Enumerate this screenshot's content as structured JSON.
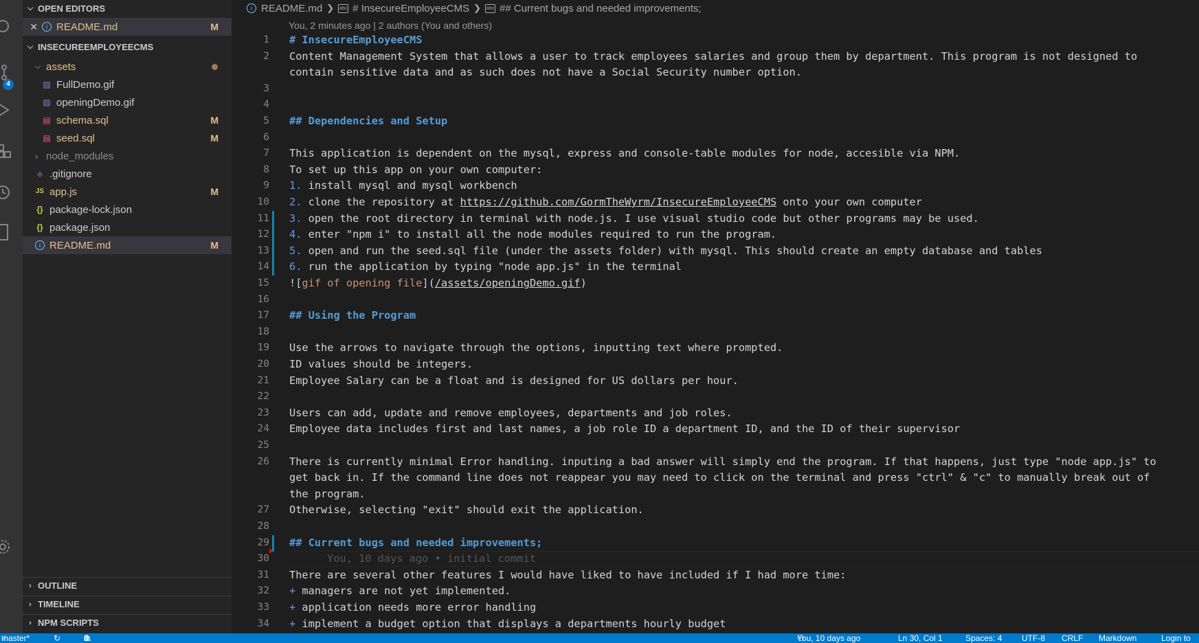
{
  "sidebar": {
    "open_editors": {
      "title": "OPEN EDITORS",
      "items": [
        {
          "label": "README.md",
          "status": "M"
        }
      ]
    },
    "explorer": {
      "title": "INSECUREEMPLOYEECMS",
      "items": [
        {
          "label": "assets",
          "type": "folder-open"
        },
        {
          "label": "FullDemo.gif",
          "type": "image"
        },
        {
          "label": "openingDemo.gif",
          "type": "image"
        },
        {
          "label": "schema.sql",
          "type": "database",
          "status": "M"
        },
        {
          "label": "seed.sql",
          "type": "database",
          "status": "M"
        },
        {
          "label": "node_modules",
          "type": "folder-closed"
        },
        {
          "label": ".gitignore",
          "type": "git"
        },
        {
          "label": "app.js",
          "type": "javascript",
          "status": "M"
        },
        {
          "label": "package-lock.json",
          "type": "json"
        },
        {
          "label": "package.json",
          "type": "json"
        },
        {
          "label": "README.md",
          "type": "info",
          "status": "M"
        }
      ]
    },
    "bottom_sections": [
      "OUTLINE",
      "TIMELINE",
      "NPM SCRIPTS"
    ],
    "source_control_badge": "4"
  },
  "editor": {
    "breadcrumb": [
      "README.md",
      "# InsecureEmployeeCMS",
      "## Current bugs and needed improvements;"
    ],
    "codelens": "You, 2 minutes ago | 2 authors (You and others)",
    "lines": [
      {
        "n": "1",
        "text": "# InsecureEmployeeCMS"
      },
      {
        "n": "2",
        "text": "Content Management System that allows a user to track employees salaries and group them by department. This program is not designed to"
      },
      {
        "n": "",
        "text": "contain sensitive data and as such does not have a Social Security number option."
      },
      {
        "n": "3",
        "text": ""
      },
      {
        "n": "4",
        "text": ""
      },
      {
        "n": "5",
        "text": "## Dependencies and Setup"
      },
      {
        "n": "6",
        "text": ""
      },
      {
        "n": "7",
        "text": "This application is dependent on the mysql, express and console-table modules for node, accesible via NPM."
      },
      {
        "n": "8",
        "text": "To set up this app on your own computer:"
      },
      {
        "n": "9",
        "prefix": "1.",
        "text": " install mysql and mysql workbench"
      },
      {
        "n": "10",
        "prefix": "2.",
        "text": " clone the repository at ",
        "link": "https://github.com/GormTheWyrm/InsecureEmployeeCMS",
        "after": " onto your own computer"
      },
      {
        "n": "11",
        "prefix": "3.",
        "text": " open the root directory in terminal with node.js. I use visual studio code but other programs may be used."
      },
      {
        "n": "12",
        "prefix": "4.",
        "text": " enter \"npm i\" to install all the node modules required to run the program."
      },
      {
        "n": "13",
        "prefix": "5.",
        "text": " open and run the seed.sql file (under the assets folder) with mysql. This should create an empty database and tables"
      },
      {
        "n": "14",
        "prefix": "6.",
        "text": " run the application by typing \"node app.js\" in the terminal"
      },
      {
        "n": "15",
        "text": "![gif of opening file](/assets/openingDemo.gif)"
      },
      {
        "n": "16",
        "text": ""
      },
      {
        "n": "17",
        "text": "## Using the Program"
      },
      {
        "n": "18",
        "text": ""
      },
      {
        "n": "19",
        "text": "Use the arrows to navigate through the options, inputting text where prompted."
      },
      {
        "n": "20",
        "text": "ID values should be integers."
      },
      {
        "n": "21",
        "text": "Employee Salary can be a float and is designed for US dollars per hour."
      },
      {
        "n": "22",
        "text": ""
      },
      {
        "n": "23",
        "text": "Users can add, update and remove employees, departments and job roles."
      },
      {
        "n": "24",
        "text": "Employee data includes first and last names, a job role ID a department ID, and the ID of their supervisor"
      },
      {
        "n": "25",
        "text": ""
      },
      {
        "n": "26",
        "text": "There is currently minimal Error handling. inputing a bad answer will simply end the program. If that happens, just type \"node app.js\" to"
      },
      {
        "n": "",
        "text": "get back in. If the command line does not reappear you may need to click on the terminal and press \"ctrl\" & \"c\" to manually break out of"
      },
      {
        "n": "",
        "text": "the program."
      },
      {
        "n": "27",
        "text": "Otherwise, selecting \"exit\" should exit the application."
      },
      {
        "n": "28",
        "text": ""
      },
      {
        "n": "29",
        "text": "## Current bugs and needed improvements;"
      },
      {
        "n": "30",
        "text": "",
        "blame": "You, 10 days ago • initial commit"
      },
      {
        "n": "31",
        "text": "There are several other features I would have liked to have included if I had more time:"
      },
      {
        "n": "32",
        "prefix": "+",
        "text": " managers are not yet implemented."
      },
      {
        "n": "33",
        "prefix": "+",
        "text": " application needs more error handling"
      },
      {
        "n": "34",
        "prefix": "+",
        "text": " implement a budget option that displays a departments hourly budget"
      }
    ]
  },
  "statusbar": {
    "branch": "master*",
    "errors": "0",
    "warnings": "0",
    "blame": "You, 10 days ago",
    "position": "Ln 30, Col 1",
    "spaces": "Spaces: 4",
    "encoding": "UTF-8",
    "eol": "CRLF",
    "language": "Markdown",
    "login": "Login to"
  },
  "colors": {
    "accent": "#007acc",
    "heading": "#569cd6",
    "modified": "#e2c08d"
  }
}
